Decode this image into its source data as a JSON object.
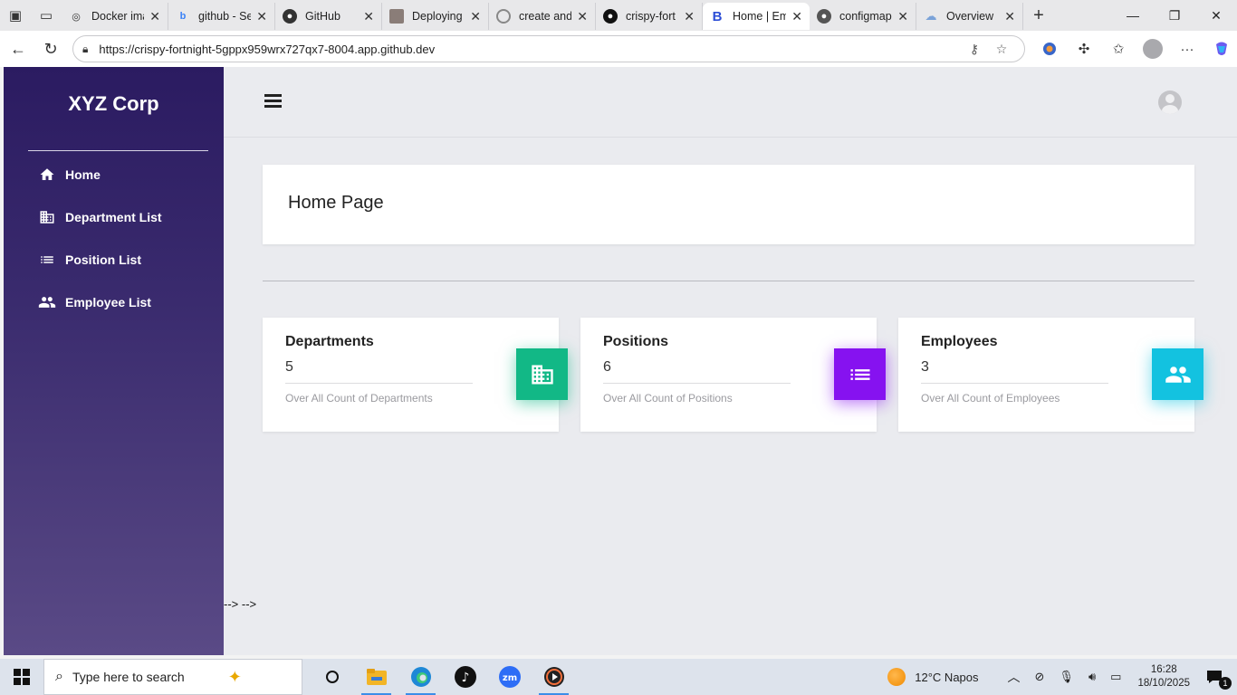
{
  "browser": {
    "tabs": [
      {
        "title": "Docker ima",
        "icon": "docker-icon"
      },
      {
        "title": "github - Se",
        "icon": "bing-icon"
      },
      {
        "title": "GitHub",
        "icon": "github-icon"
      },
      {
        "title": "Deploying",
        "icon": "page-thumbnail-icon"
      },
      {
        "title": "create and",
        "icon": "github-icon"
      },
      {
        "title": "crispy-fort",
        "icon": "github-icon"
      },
      {
        "title": "Home | Em",
        "icon": "bootstrap-icon",
        "active": true
      },
      {
        "title": "configmap",
        "icon": "github-icon"
      },
      {
        "title": "Overview",
        "icon": "cloud-icon"
      }
    ],
    "url": "https://crispy-fortnight-5gppx959wrx727qx7-8004.app.github.dev"
  },
  "sidebar": {
    "brand": "XYZ Corp",
    "items": [
      {
        "label": "Home",
        "icon": "home-icon"
      },
      {
        "label": "Department List",
        "icon": "building-icon"
      },
      {
        "label": "Position List",
        "icon": "list-icon"
      },
      {
        "label": "Employee List",
        "icon": "people-icon"
      }
    ]
  },
  "main": {
    "page_title": "Home Page",
    "cards": [
      {
        "title": "Departments",
        "value": "5",
        "desc": "Over All Count of Departments",
        "icon": "building-icon",
        "color": "#12b886"
      },
      {
        "title": "Positions",
        "value": "6",
        "desc": "Over All Count of Positions",
        "icon": "list-icon",
        "color": "#8612f0"
      },
      {
        "title": "Employees",
        "value": "3",
        "desc": "Over All Count of Employees",
        "icon": "people-icon",
        "color": "#13c2e0"
      }
    ],
    "stray_text": "--> -->"
  },
  "taskbar": {
    "search_placeholder": "Type here to search",
    "weather": "12°C  Napos",
    "time": "16:28",
    "date": "18/10/2025",
    "notification_count": "1"
  }
}
